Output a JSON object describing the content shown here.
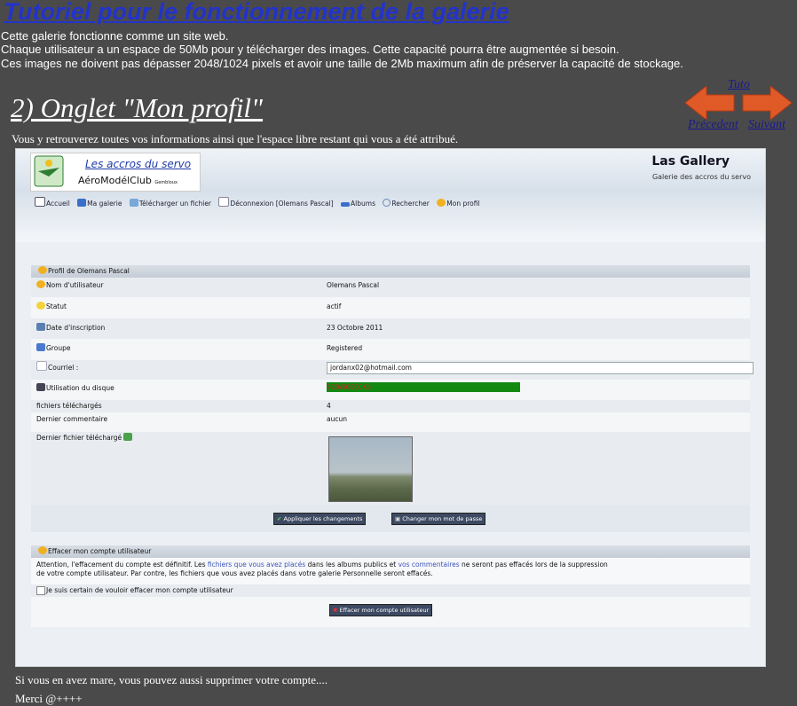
{
  "page": {
    "title": "Tutoriel pour le fonctionnement de la galerie",
    "intro": [
      "Cette galerie fonctionne comme un site web.",
      "Chaque utilisateur a un espace de 50Mb pour y télécharger des images. Cette capacité pourra être augmentée si besoin.",
      "Ces images ne doivent pas dépasser 2048/1024 pixels et avoir une taille de 2Mb maximum afin de préserver la capacité de stockage."
    ],
    "section_title": "2) Onglet \"Mon profil\"",
    "section_sub": "Vous y retrouverez toutes vos informations ainsi que l'espace libre restant qui vous a été attribué.",
    "outro": [
      "Si vous en avez mare, vous pouvez aussi supprimer votre compte....",
      "Merci @++++"
    ]
  },
  "nav": {
    "tuto": "Tuto",
    "prev": "Précedent",
    "next": "Suivant",
    "arrow_color": "#e05a28"
  },
  "gallery": {
    "logo_title": "Les accros du servo",
    "logo_sub": "AéroModélClub",
    "logo_small": "Gembloux",
    "site_name": "Las Gallery",
    "site_desc": "Galerie des accros du servo",
    "menu": [
      "Accueil",
      "Ma galerie",
      "Télécharger un fichier",
      "Déconnexion [Olemans Pascal]",
      "Albums",
      "Rechercher",
      "Mon profil"
    ],
    "profile": {
      "header": "Profil de Olemans Pascal",
      "rows": [
        {
          "label": "Nom d'utilisateur",
          "value": "Olemans Pascal"
        },
        {
          "label": "Statut",
          "value": "actif"
        },
        {
          "label": "Date d'inscription",
          "value": "23 Octobre 2011"
        },
        {
          "label": "Groupe",
          "value": "Registered"
        },
        {
          "label": "Courriel :",
          "value": "jordanx02@hotmail.com"
        },
        {
          "label": "Utilisation du disque",
          "value": "920/50000Ko"
        },
        {
          "label": "fichiers téléchargés",
          "value": "4"
        },
        {
          "label": "Dernier commentaire",
          "value": "aucun"
        },
        {
          "label": "Dernier fichier téléchargé",
          "value": ""
        }
      ],
      "apply_btn": "Appliquer les changements",
      "password_btn": "Changer mon mot de passe"
    },
    "delete": {
      "header": "Effacer mon compte utilisateur",
      "warning_1": "Attention, l'effacement du compte est définitif. Les ",
      "link_files": "fichiers que vous avez placés",
      "warning_2": " dans les albums publics et ",
      "link_comments": "vos commentaires",
      "warning_3": " ne seront pas effacés lors de la suppression",
      "warning_4": "de votre compte utilisateur. Par contre, les fichiers que vous avez placés dans votre galerie Personnelle seront effacés.",
      "confirm_label": "Je suis certain de vouloir effacer mon compte utilisateur",
      "delete_btn": "Effacer mon compte utilisateur"
    }
  }
}
